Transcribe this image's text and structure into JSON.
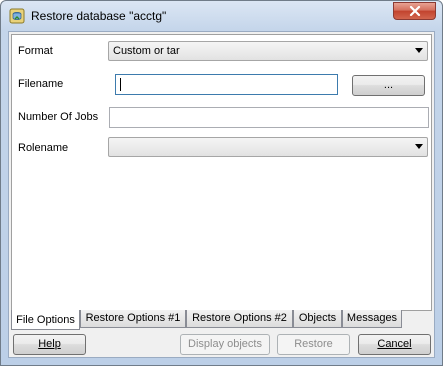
{
  "window": {
    "title": "Restore database \"acctg\"",
    "close_label": "close"
  },
  "form": {
    "format": {
      "label": "Format",
      "value": "Custom or tar"
    },
    "filename": {
      "label": "Filename",
      "value": "",
      "browse_label": "..."
    },
    "jobs": {
      "label": "Number Of Jobs",
      "value": ""
    },
    "rolename": {
      "label": "Rolename",
      "value": ""
    }
  },
  "tabs": [
    {
      "label": "File Options",
      "active": true
    },
    {
      "label": "Restore Options #1",
      "active": false
    },
    {
      "label": "Restore Options #2",
      "active": false
    },
    {
      "label": "Objects",
      "active": false
    },
    {
      "label": "Messages",
      "active": false
    }
  ],
  "buttons": {
    "help": "Help",
    "display_objects": "Display objects",
    "restore": "Restore",
    "cancel": "Cancel"
  },
  "icons": {
    "app": "database-restore-icon",
    "close": "close-icon",
    "dropdown": "chevron-down-icon"
  },
  "colors": {
    "title_gradient_top": "#dbe6f4",
    "close_button": "#c2432e",
    "client_bg": "#f0f0f0",
    "focus_border": "#3d7bad"
  }
}
